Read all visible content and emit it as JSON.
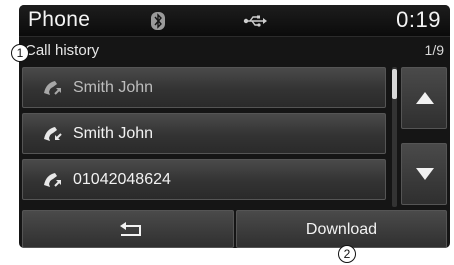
{
  "status_bar": {
    "title": "Phone",
    "time": "0:19",
    "icons": [
      "bluetooth-icon",
      "usb-icon"
    ]
  },
  "subheader": {
    "title": "Call history",
    "page_indicator": "1/9"
  },
  "call_list": [
    {
      "label": "Smith John",
      "icon": "outgoing-call-icon",
      "dimmed": true
    },
    {
      "label": "Smith John",
      "icon": "incoming-call-icon",
      "dimmed": false
    },
    {
      "label": "01042048624",
      "icon": "outgoing-call-icon",
      "dimmed": false
    }
  ],
  "scroll": {
    "up_icon": "up-arrow-icon",
    "down_icon": "down-arrow-icon"
  },
  "bottom_bar": {
    "back_icon": "back-icon",
    "download_label": "Download"
  },
  "callouts": {
    "one": "1",
    "two": "2"
  },
  "colors": {
    "background": "#151515",
    "button": "#3a3a3a",
    "text": "#f2f2f2"
  }
}
